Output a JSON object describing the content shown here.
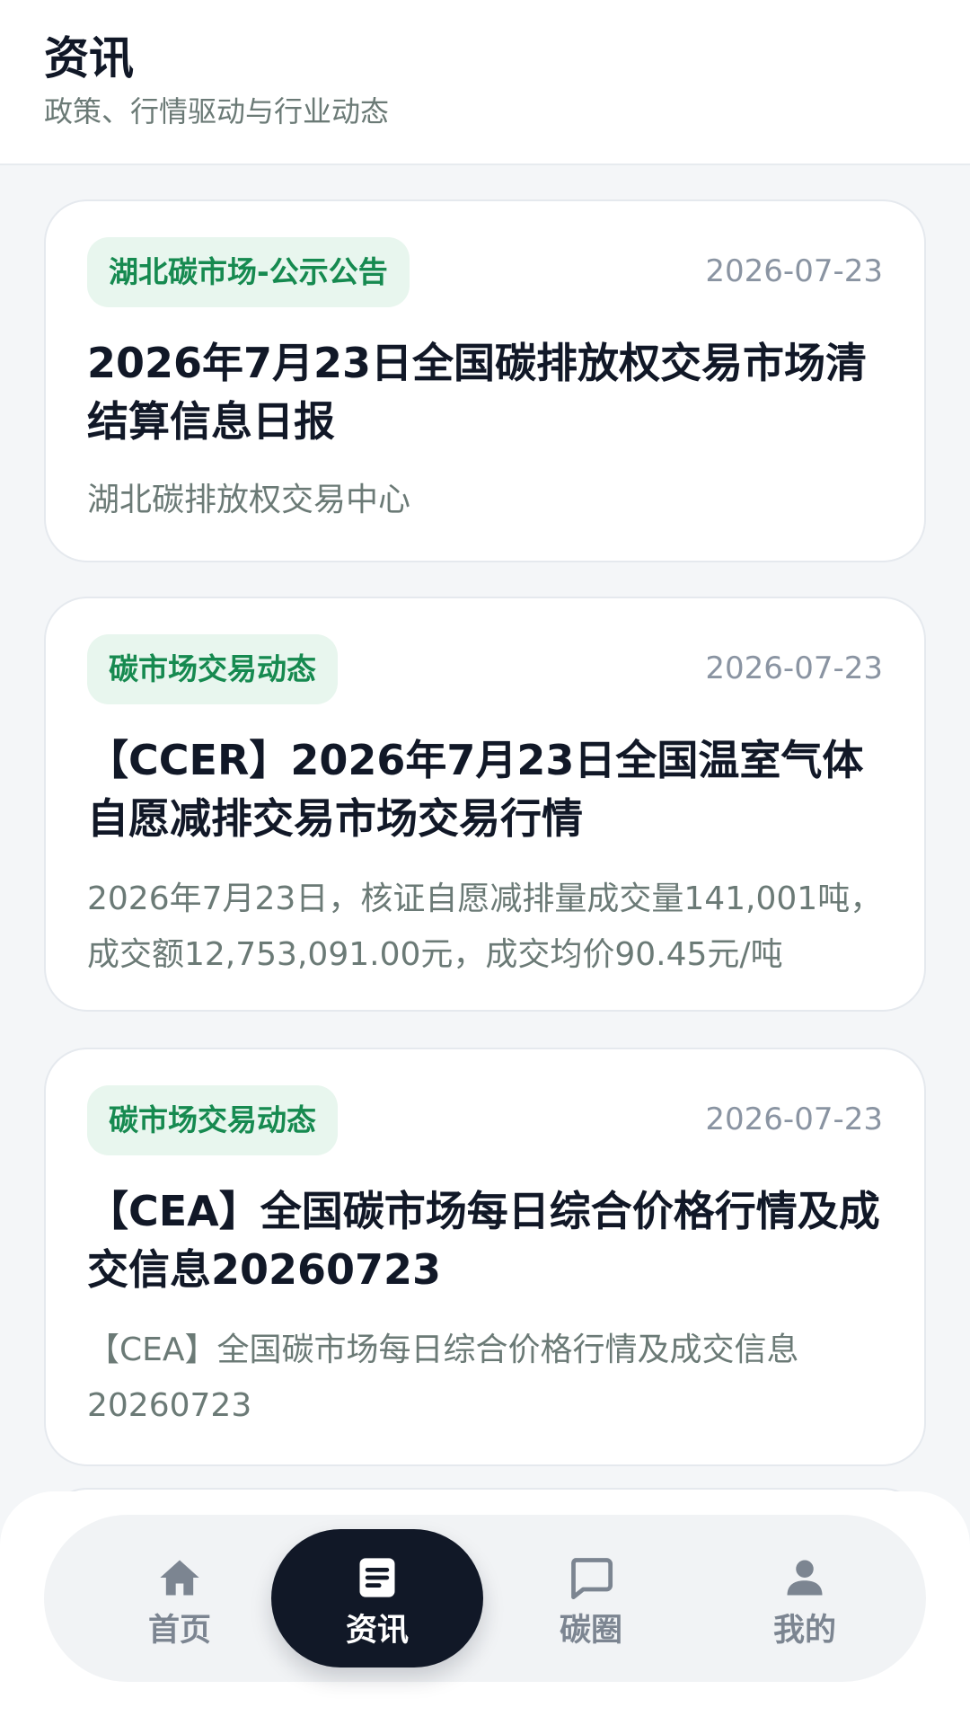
{
  "header": {
    "title": "资讯",
    "subtitle": "政策、行情驱动与行业动态"
  },
  "news": [
    {
      "tag": "湖北碳市场-公示公告",
      "date": "2026-07-23",
      "title": "2026年7月23日全国碳排放权交易市场清结算信息日报",
      "summary": "湖北碳排放权交易中心"
    },
    {
      "tag": "碳市场交易动态",
      "date": "2026-07-23",
      "title": "【CCER】2026年7月23日全国温室气体自愿减排交易市场交易行情",
      "summary": "2026年7月23日，核证自愿减排量成交量141,001吨，成交额12,753,091.00元，成交均价90.45元/吨"
    },
    {
      "tag": "碳市场交易动态",
      "date": "2026-07-23",
      "title": "【CEA】全国碳市场每日综合价格行情及成交信息20260723",
      "summary": "【CEA】全国碳市场每日综合价格行情及成交信息20260723"
    }
  ],
  "tabs": [
    {
      "label": "首页",
      "icon": "home-icon"
    },
    {
      "label": "资讯",
      "icon": "document-icon"
    },
    {
      "label": "碳圈",
      "icon": "chat-icon"
    },
    {
      "label": "我的",
      "icon": "user-icon"
    }
  ],
  "colors": {
    "tag_bg": "#e8f6ee",
    "tag_text": "#168a50",
    "active_tab": "#111827",
    "muted_text": "#6b7a76"
  }
}
